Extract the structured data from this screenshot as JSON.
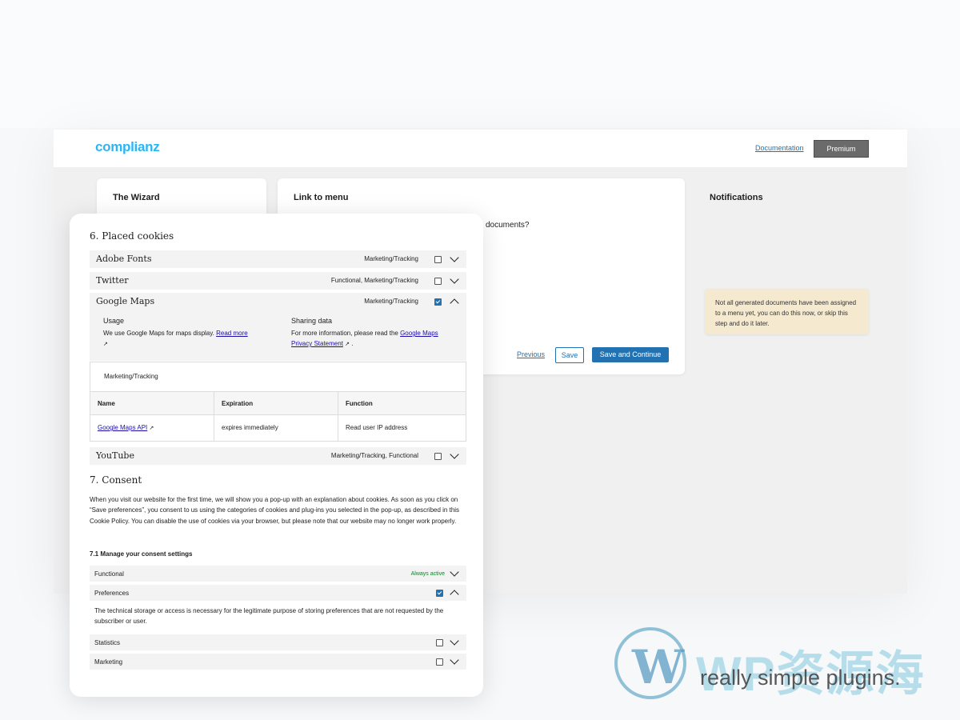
{
  "header": {
    "logo": "complianz",
    "documentation_link": "Documentation",
    "premium_button": "Premium"
  },
  "wizard": {
    "title": "The Wizard"
  },
  "link_to_menu": {
    "title": "Link to menu",
    "question_fragment": "documents?",
    "previous": "Previous",
    "save": "Save",
    "save_continue": "Save and Continue"
  },
  "notifications": {
    "title": "Notifications",
    "message": "Not all generated documents have been assigned to a menu yet, you can do this now, or skip this step and do it later."
  },
  "policy": {
    "placed_cookies_heading": "6. Placed cookies",
    "cookies": [
      {
        "name": "Adobe Fonts",
        "category": "Marketing/Tracking",
        "checked": false,
        "expanded": false
      },
      {
        "name": "Twitter",
        "category": "Functional, Marketing/Tracking",
        "checked": false,
        "expanded": false
      },
      {
        "name": "Google Maps",
        "category": "Marketing/Tracking",
        "checked": true,
        "expanded": true
      },
      {
        "name": "YouTube",
        "category": "Marketing/Tracking, Functional",
        "checked": false,
        "expanded": false
      }
    ],
    "google_maps_detail": {
      "usage_label": "Usage",
      "usage_text": "We use Google Maps for maps display.",
      "read_more": "Read more",
      "sharing_label": "Sharing data",
      "sharing_text": "For more information, please read the",
      "privacy_link": "Google Maps Privacy Statement",
      "purpose": "Marketing/Tracking",
      "table_headers": [
        "Name",
        "Expiration",
        "Function"
      ],
      "table_row": [
        "Google Maps API",
        "expires immediately",
        "Read user IP address"
      ]
    },
    "consent_heading": "7. Consent",
    "consent_text": "When you visit our website for the first time, we will show you a pop-up with an explanation about cookies. As soon as you click on “Save preferences”, you consent to us using the categories of cookies and plug-ins you selected in the pop-up, as described in this Cookie Policy. You can disable the use of cookies via your browser, but please note that our website may no longer work properly.",
    "manage_heading": "7.1 Manage your consent settings",
    "consent_rows": [
      {
        "label": "Functional",
        "status": "Always active"
      },
      {
        "label": "Preferences",
        "checked": true
      },
      {
        "label": "Statistics",
        "checked": false
      },
      {
        "label": "Marketing",
        "checked": false
      }
    ],
    "preferences_description": "The technical storage or access is necessary for the legitimate purpose of storing preferences that are not requested by the subscriber or user."
  },
  "watermark": {
    "brand": "WP资源海",
    "sub": "really simple plugins."
  }
}
